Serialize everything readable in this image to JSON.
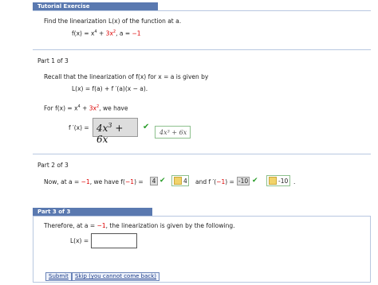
{
  "part0": {
    "header": "Tutorial Exercise",
    "prompt": "Find the linearization L(x) of the function at a.",
    "function_lhs": "f(x) = x",
    "exp4": "4",
    "plus": " + ",
    "term3x": "3x",
    "exp2": "2",
    "a_text": ",   a = ",
    "a_value": "−1"
  },
  "part1": {
    "label": "Part 1 of 3",
    "recall": "Recall that the linearization of  f(x)  for x = a is given by",
    "formula": "L(x) = f(a) + f ′(a)(x − a).",
    "for_text": "For  f(x) = x",
    "exp4": "4",
    "plus": " + ",
    "term3x": "3x",
    "exp2": "2",
    "we_have": ",  we have",
    "fprime_label": "f ′(x) =",
    "answer_main": "4x",
    "answer_exp": "3",
    "answer_rest": " + 6x",
    "key_answer": "4x³ + 6x"
  },
  "part2": {
    "label": "Part 2 of 3",
    "now_text": "Now, at  a = ",
    "a_value": "−1",
    "we_have_text": ",  we have  f(",
    "a_value2": "−1",
    "eq_text": ") = ",
    "f_answer": "4",
    "f_key": "4",
    "and_text": "and  f ′(",
    "a_value3": "−1",
    "eq_text2": ") = ",
    "fp_answer": "-10",
    "fp_key": "-10",
    "period": "."
  },
  "part3": {
    "header": "Part 3 of 3",
    "therefore": "Therefore, at  a = ",
    "a_value": "−1",
    "rest": ",  the linearization is given by the following.",
    "L_label": "L(x) =",
    "L_value": "",
    "submit": "Submit",
    "skip": "Skip (you cannot come back)"
  },
  "colors": {
    "header_bg": "#5a79b0",
    "accent_red": "#dd0000",
    "check_green": "#2a9d2a"
  }
}
